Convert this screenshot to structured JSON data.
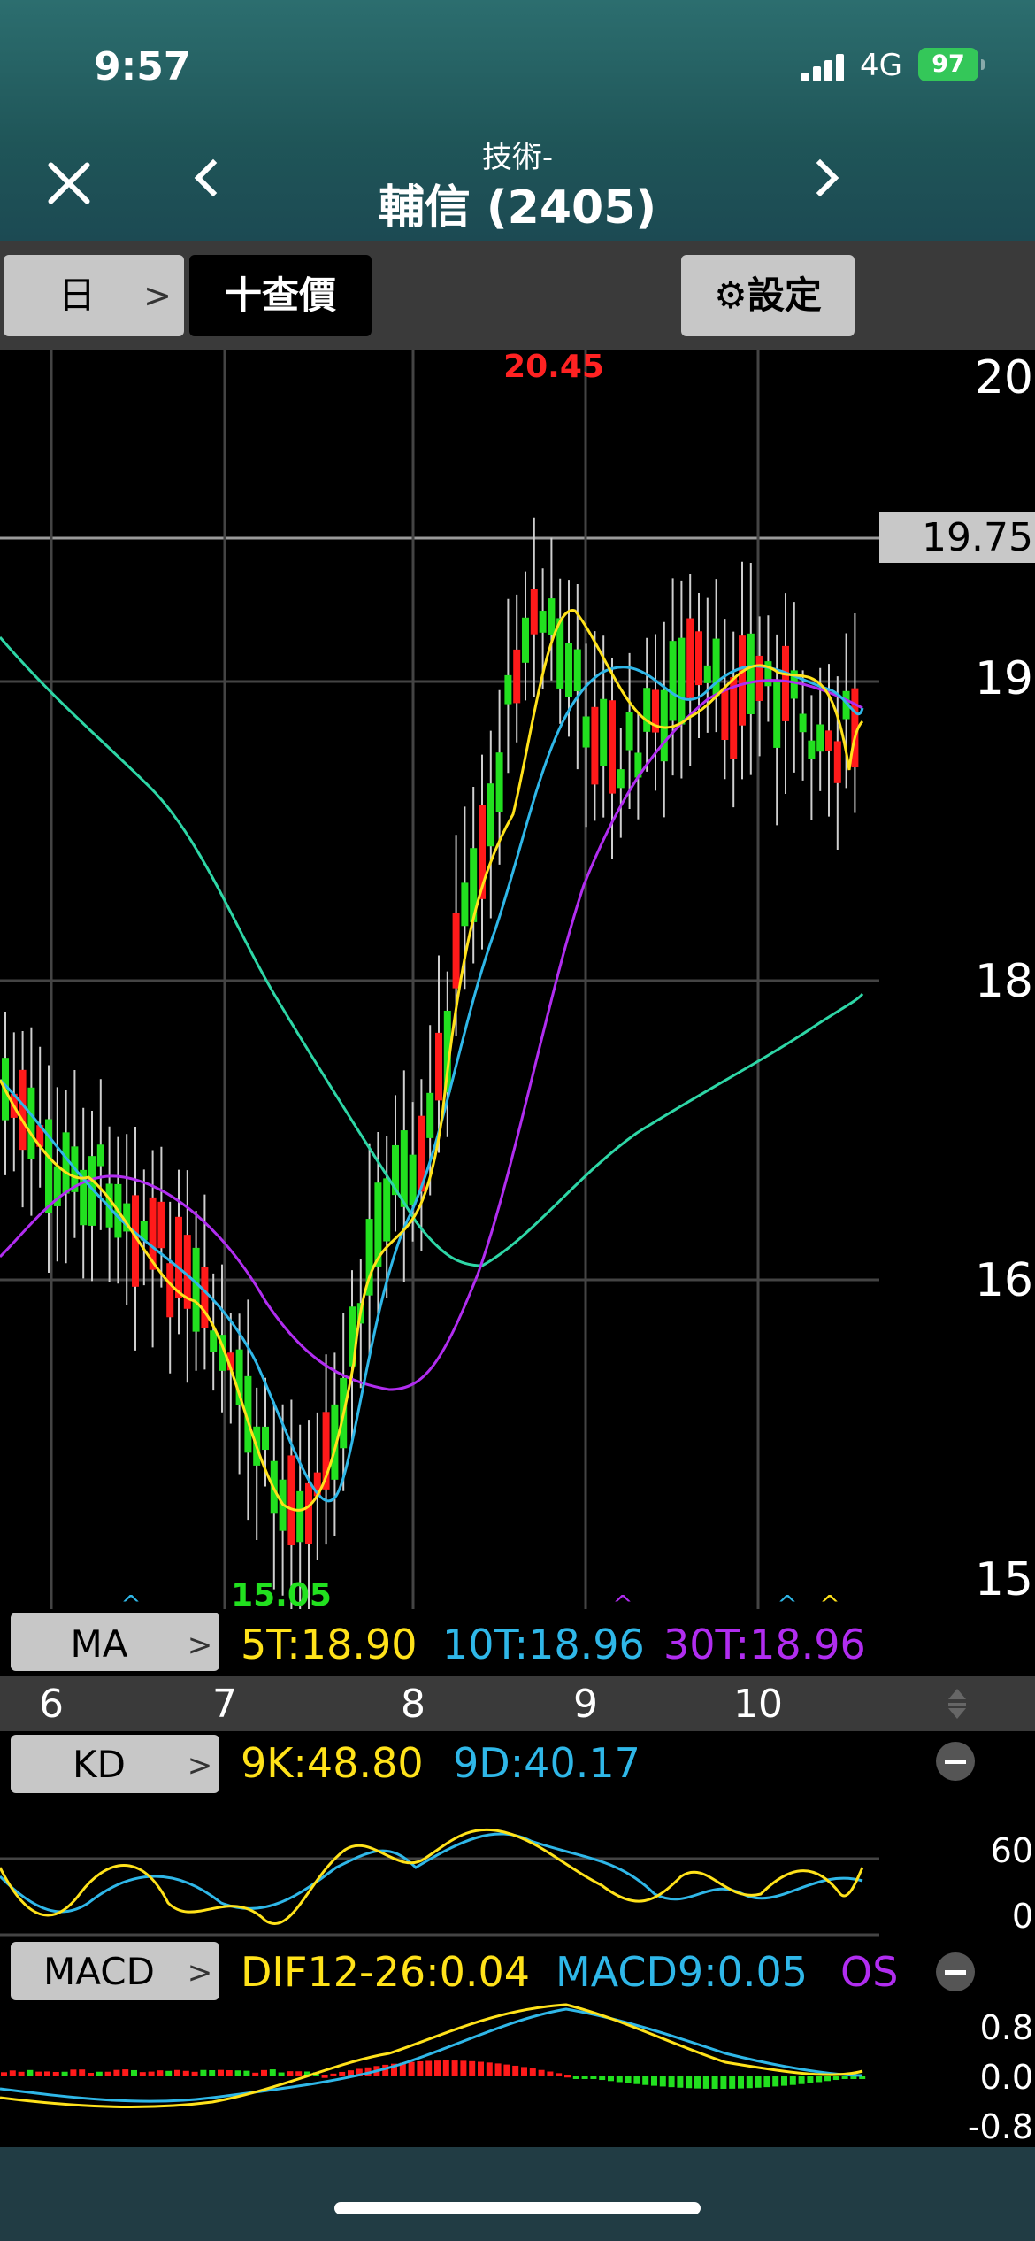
{
  "status_bar": {
    "time": "9:57",
    "network": "4G",
    "battery": "97"
  },
  "nav": {
    "subtitle": "技術-",
    "title": "輔信 (2405)"
  },
  "toolbar": {
    "period": "日",
    "period_arrow": ">",
    "add_quote": "十查價",
    "settings": "設定"
  },
  "price_chart": {
    "y_ticks": [
      {
        "label": "20",
        "v": 20
      },
      {
        "label": "19",
        "v": 19
      },
      {
        "label": "18",
        "v": 18
      },
      {
        "label": "16",
        "v": 16
      },
      {
        "label": "15",
        "v": 15
      }
    ],
    "current_price": "19.75",
    "high_label": "20.45",
    "low_label": "15.05",
    "markers": [
      "^",
      "^",
      "^",
      "^"
    ]
  },
  "ma_panel": {
    "button": "MA",
    "arrow": ">",
    "ma5": "5T:18.90",
    "ma10": "10T:18.96",
    "ma30": "30T:18.96"
  },
  "x_axis": {
    "labels": [
      "6",
      "7",
      "8",
      "9",
      "10"
    ]
  },
  "kd_panel": {
    "button": "KD",
    "arrow": ">",
    "k": "9K:48.80",
    "d": "9D:40.17",
    "y_ticks": [
      "60",
      "0"
    ]
  },
  "macd_panel": {
    "button": "MACD",
    "arrow": ">",
    "dif": "DIF12-26:0.04",
    "macd": "MACD9:0.05",
    "osc": "OS",
    "y_ticks": [
      "0.8",
      "0.0",
      "-0.8"
    ]
  },
  "colors": {
    "up": "#ff1a1a",
    "down": "#22e01f",
    "ma5": "#ffe21a",
    "ma10": "#2fb7e8",
    "ma30": "#b12df0",
    "ma60": "#2ed6a6",
    "nav_bg": "#1f5558",
    "toolbar_bg": "#3a3a3a"
  }
}
